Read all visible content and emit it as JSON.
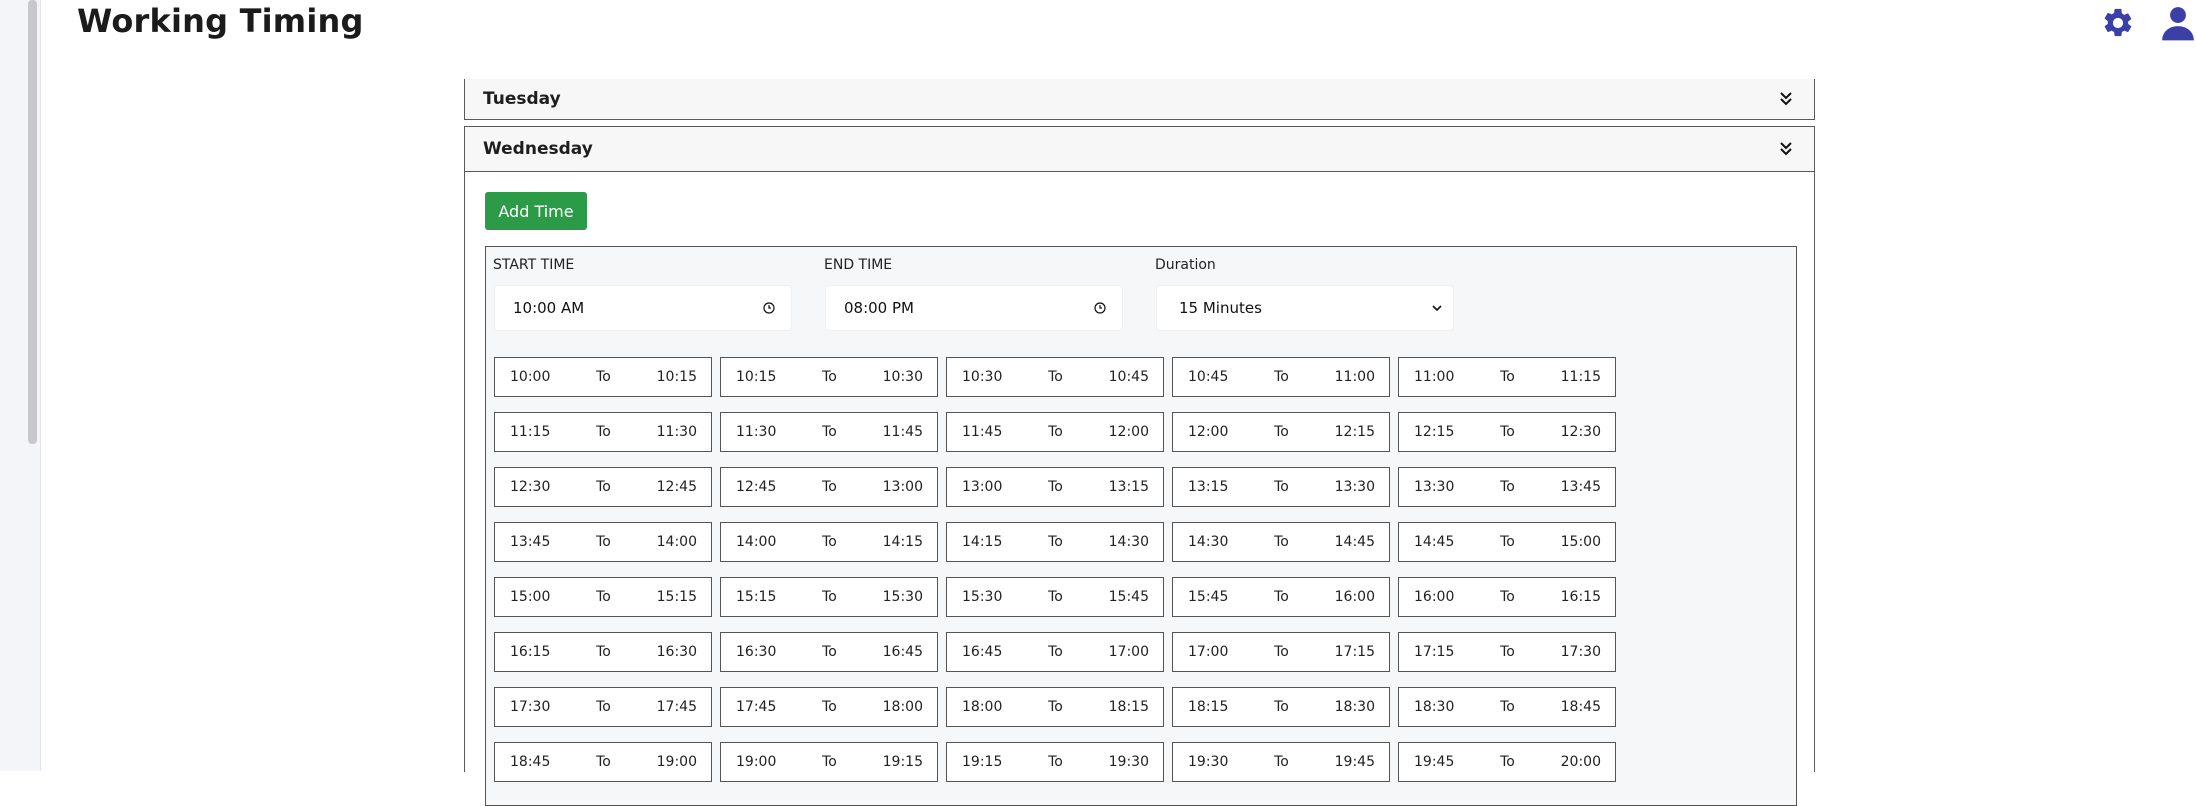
{
  "header": {
    "title": "Working Timing"
  },
  "icons": {
    "settings": "gear-icon",
    "profile": "user-icon",
    "accent": "#3b3fa8"
  },
  "days": [
    {
      "name": "Tuesday",
      "expanded": false
    },
    {
      "name": "Wednesday",
      "expanded": true
    }
  ],
  "form": {
    "add_time_label": "Add Time",
    "start_time_label": "START TIME",
    "start_time_value": "10:00  AM",
    "end_time_label": "END TIME",
    "end_time_value": "08:00  PM",
    "duration_label": "Duration",
    "duration_value": "15 Minutes"
  },
  "slot_separator": "To",
  "slots": [
    [
      "10:00",
      "10:15"
    ],
    [
      "10:15",
      "10:30"
    ],
    [
      "10:30",
      "10:45"
    ],
    [
      "10:45",
      "11:00"
    ],
    [
      "11:00",
      "11:15"
    ],
    [
      "11:15",
      "11:30"
    ],
    [
      "11:30",
      "11:45"
    ],
    [
      "11:45",
      "12:00"
    ],
    [
      "12:00",
      "12:15"
    ],
    [
      "12:15",
      "12:30"
    ],
    [
      "12:30",
      "12:45"
    ],
    [
      "12:45",
      "13:00"
    ],
    [
      "13:00",
      "13:15"
    ],
    [
      "13:15",
      "13:30"
    ],
    [
      "13:30",
      "13:45"
    ],
    [
      "13:45",
      "14:00"
    ],
    [
      "14:00",
      "14:15"
    ],
    [
      "14:15",
      "14:30"
    ],
    [
      "14:30",
      "14:45"
    ],
    [
      "14:45",
      "15:00"
    ],
    [
      "15:00",
      "15:15"
    ],
    [
      "15:15",
      "15:30"
    ],
    [
      "15:30",
      "15:45"
    ],
    [
      "15:45",
      "16:00"
    ],
    [
      "16:00",
      "16:15"
    ],
    [
      "16:15",
      "16:30"
    ],
    [
      "16:30",
      "16:45"
    ],
    [
      "16:45",
      "17:00"
    ],
    [
      "17:00",
      "17:15"
    ],
    [
      "17:15",
      "17:30"
    ],
    [
      "17:30",
      "17:45"
    ],
    [
      "17:45",
      "18:00"
    ],
    [
      "18:00",
      "18:15"
    ],
    [
      "18:15",
      "18:30"
    ],
    [
      "18:30",
      "18:45"
    ],
    [
      "18:45",
      "19:00"
    ],
    [
      "19:00",
      "19:15"
    ],
    [
      "19:15",
      "19:30"
    ],
    [
      "19:30",
      "19:45"
    ],
    [
      "19:45",
      "20:00"
    ]
  ],
  "colors": {
    "add_button": "#2b9b48",
    "icon_accent": "#3b3fa8"
  }
}
